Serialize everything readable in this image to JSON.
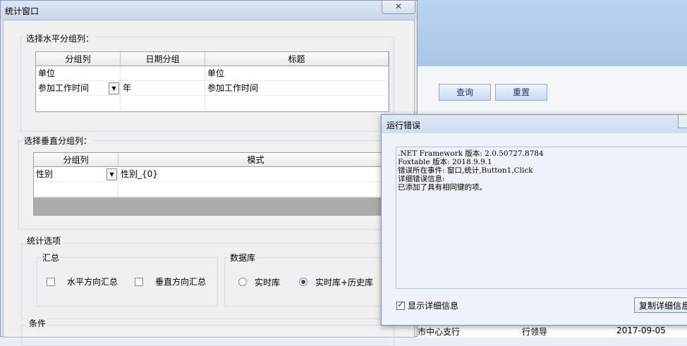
{
  "background_app": {
    "query_button": "查询",
    "reset_button": "重置",
    "row_branch": "市中心支行",
    "row_role": "行领导",
    "row_date": "2017-09-05"
  },
  "window": {
    "title": "统计窗口",
    "horizontal_group": {
      "legend": "选择水平分组列：",
      "headers": [
        "分组列",
        "日期分组",
        "标题"
      ],
      "rows": [
        {
          "col": "单位",
          "date": "",
          "title": "单位"
        },
        {
          "col": "参加工作时间",
          "date": "年",
          "title": "参加工作时间"
        }
      ]
    },
    "vertical_group": {
      "legend": "选择垂直分组列：",
      "headers": [
        "分组列",
        "模式"
      ],
      "rows": [
        {
          "col": "性别",
          "mode": "性别_{0}"
        }
      ]
    },
    "stat_options": {
      "legend": "统计选项",
      "summary": {
        "legend": "汇总",
        "horizontal": "水平方向汇总",
        "vertical": "垂直方向汇总"
      },
      "database": {
        "legend": "数据库",
        "realtime": "实时库",
        "realtime_history": "实时库+历史库",
        "selected": "实时库+历史库"
      }
    },
    "condition": {
      "legend": "条件"
    }
  },
  "error_dialog": {
    "title": "运行错误",
    "lines": [
      ".NET Framework 版本: 2.0.50727.8784",
      "Foxtable 版本: 2018.9.9.1",
      "错误所在事件: 窗口,统计,Button1,Click",
      "详细错误信息:",
      "已添加了具有相同键的项。"
    ],
    "show_details_label": "显示详细信息",
    "show_details_checked": true,
    "copy_button": "复制详细信息"
  }
}
